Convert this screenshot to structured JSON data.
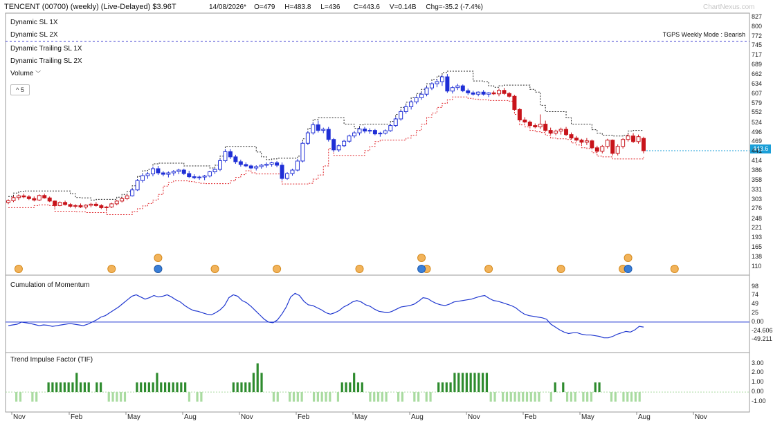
{
  "header": {
    "symbol": "TENCENT (00700)",
    "period": "(weekly)",
    "status": "(Live-Delayed)",
    "mktcap": "$3.96T",
    "date": "14/08/2026*",
    "open": "O=479",
    "high": "H=483.8",
    "low": "L=436",
    "close": "C=443.6",
    "volume": "V=0.14B",
    "change": "Chg=-35.2 (-7.4%)",
    "watermark": "ChartNexus.com"
  },
  "legend": {
    "sl1": "Dynamic SL 1X",
    "sl2": "Dynamic SL 2X",
    "trail1": "Dynamic Trailing SL 1X",
    "trail2": "Dynamic Trailing SL 2X",
    "volume": "Volume",
    "collapse": "^ 5"
  },
  "mode_label": "TGPS Weekly Mode : Bearish",
  "last_price_label": "443.6",
  "colors": {
    "bull": "#1f2fd6",
    "bear": "#c8141b",
    "trail_black": "#222222",
    "trail_red": "#e0262b",
    "momentum": "#2038d0",
    "tif_dark": "#2e8b2e",
    "tif_light": "#a9dba0",
    "price_tag": "#1a9fd8",
    "dashed_blue": "#3a3ad0"
  },
  "x_months": [
    "Nov",
    "Feb",
    "May",
    "Aug",
    "Nov",
    "Feb",
    "May",
    "Aug",
    "Nov",
    "Feb",
    "May",
    "Aug",
    "Nov"
  ],
  "price_ticks": [
    "827",
    "800",
    "772",
    "745",
    "717",
    "689",
    "662",
    "634",
    "607",
    "579",
    "552",
    "524",
    "496",
    "469",
    "441",
    "414",
    "386",
    "358",
    "331",
    "303",
    "276",
    "248",
    "221",
    "193",
    "165",
    "138",
    "110"
  ],
  "momentum_ticks": [
    "98",
    "74",
    "49",
    "25",
    "0.00",
    "-24.606",
    "-49.211"
  ],
  "tif_ticks": [
    "3.00",
    "2.00",
    "1.00",
    "0.00",
    "-1.00"
  ],
  "chart_data": [
    {
      "type": "candlestick",
      "title": "TENCENT (00700) (weekly)",
      "ylim": [
        110,
        827
      ],
      "ohlc": [
        [
          295,
          304,
          290,
          300
        ],
        [
          300,
          314,
          296,
          309
        ],
        [
          309,
          318,
          302,
          314
        ],
        [
          314,
          320,
          307,
          311
        ],
        [
          311,
          316,
          302,
          306
        ],
        [
          306,
          312,
          298,
          302
        ],
        [
          302,
          318,
          299,
          315
        ],
        [
          315,
          320,
          306,
          308
        ],
        [
          308,
          312,
          296,
          299
        ],
        [
          299,
          301,
          280,
          286
        ],
        [
          286,
          298,
          284,
          295
        ],
        [
          295,
          300,
          286,
          289
        ],
        [
          289,
          293,
          280,
          284
        ],
        [
          284,
          290,
          278,
          286
        ],
        [
          286,
          292,
          279,
          282
        ],
        [
          282,
          290,
          276,
          287
        ],
        [
          287,
          294,
          281,
          290
        ],
        [
          290,
          296,
          283,
          286
        ],
        [
          286,
          290,
          276,
          280
        ],
        [
          280,
          285,
          270,
          282
        ],
        [
          282,
          294,
          279,
          291
        ],
        [
          291,
          302,
          287,
          299
        ],
        [
          299,
          310,
          295,
          306
        ],
        [
          306,
          318,
          302,
          314
        ],
        [
          314,
          335,
          312,
          331
        ],
        [
          331,
          362,
          328,
          358
        ],
        [
          358,
          378,
          352,
          372
        ],
        [
          372,
          382,
          363,
          377
        ],
        [
          377,
          398,
          370,
          392
        ],
        [
          392,
          400,
          374,
          380
        ],
        [
          380,
          385,
          370,
          376
        ],
        [
          376,
          384,
          367,
          380
        ],
        [
          380,
          388,
          372,
          384
        ],
        [
          384,
          392,
          376,
          388
        ],
        [
          388,
          392,
          374,
          378
        ],
        [
          378,
          386,
          365,
          369
        ],
        [
          369,
          376,
          362,
          366
        ],
        [
          366,
          372,
          360,
          368
        ],
        [
          368,
          374,
          359,
          371
        ],
        [
          371,
          386,
          367,
          383
        ],
        [
          383,
          394,
          377,
          390
        ],
        [
          390,
          420,
          385,
          415
        ],
        [
          415,
          448,
          410,
          441
        ],
        [
          441,
          448,
          420,
          426
        ],
        [
          426,
          432,
          406,
          412
        ],
        [
          412,
          418,
          398,
          404
        ],
        [
          404,
          410,
          396,
          400
        ],
        [
          400,
          404,
          390,
          394
        ],
        [
          394,
          402,
          387,
          398
        ],
        [
          398,
          406,
          392,
          402
        ],
        [
          402,
          410,
          395,
          405
        ],
        [
          405,
          412,
          398,
          409
        ],
        [
          409,
          414,
          396,
          402
        ],
        [
          402,
          410,
          358,
          364
        ],
        [
          364,
          382,
          360,
          378
        ],
        [
          378,
          392,
          372,
          388
        ],
        [
          388,
          420,
          384,
          414
        ],
        [
          414,
          470,
          410,
          465
        ],
        [
          465,
          500,
          460,
          495
        ],
        [
          495,
          525,
          490,
          518
        ],
        [
          518,
          530,
          496,
          502
        ],
        [
          502,
          510,
          494,
          505
        ],
        [
          505,
          512,
          470,
          476
        ],
        [
          476,
          480,
          440,
          446
        ],
        [
          446,
          462,
          440,
          458
        ],
        [
          458,
          475,
          454,
          471
        ],
        [
          471,
          490,
          466,
          486
        ],
        [
          486,
          500,
          480,
          495
        ],
        [
          495,
          510,
          488,
          506
        ],
        [
          506,
          512,
          494,
          500
        ],
        [
          500,
          508,
          492,
          502
        ],
        [
          502,
          506,
          488,
          492
        ],
        [
          492,
          498,
          484,
          494
        ],
        [
          494,
          505,
          490,
          501
        ],
        [
          501,
          520,
          498,
          516
        ],
        [
          516,
          540,
          512,
          535
        ],
        [
          535,
          560,
          530,
          556
        ],
        [
          556,
          575,
          550,
          570
        ],
        [
          570,
          588,
          562,
          584
        ],
        [
          584,
          600,
          578,
          596
        ],
        [
          596,
          612,
          590,
          606
        ],
        [
          606,
          628,
          600,
          624
        ],
        [
          624,
          640,
          618,
          636
        ],
        [
          636,
          650,
          626,
          642
        ],
        [
          642,
          660,
          630,
          656
        ],
        [
          656,
          664,
          610,
          615
        ],
        [
          615,
          630,
          608,
          625
        ],
        [
          625,
          636,
          618,
          630
        ],
        [
          630,
          634,
          612,
          616
        ],
        [
          616,
          622,
          604,
          610
        ],
        [
          610,
          616,
          602,
          606
        ],
        [
          606,
          614,
          600,
          612
        ],
        [
          612,
          618,
          602,
          606
        ],
        [
          606,
          612,
          598,
          610
        ],
        [
          610,
          616,
          604,
          607
        ],
        [
          607,
          622,
          600,
          617
        ],
        [
          617,
          624,
          604,
          608
        ],
        [
          608,
          612,
          596,
          600
        ],
        [
          600,
          604,
          558,
          562
        ],
        [
          562,
          566,
          528,
          532
        ],
        [
          532,
          540,
          522,
          526
        ],
        [
          526,
          530,
          512,
          516
        ],
        [
          516,
          522,
          508,
          512
        ],
        [
          512,
          548,
          506,
          520
        ],
        [
          520,
          530,
          498,
          502
        ],
        [
          502,
          510,
          490,
          494
        ],
        [
          494,
          504,
          488,
          500
        ],
        [
          500,
          510,
          490,
          505
        ],
        [
          505,
          512,
          486,
          490
        ],
        [
          490,
          496,
          476,
          480
        ],
        [
          480,
          486,
          470,
          474
        ],
        [
          474,
          478,
          462,
          468
        ],
        [
          468,
          480,
          460,
          472
        ],
        [
          472,
          476,
          448,
          452
        ],
        [
          452,
          458,
          438,
          442
        ],
        [
          442,
          460,
          436,
          456
        ],
        [
          456,
          478,
          450,
          474
        ],
        [
          474,
          476,
          430,
          436
        ],
        [
          436,
          462,
          430,
          456
        ],
        [
          456,
          480,
          450,
          476
        ],
        [
          476,
          492,
          470,
          486
        ],
        [
          486,
          494,
          466,
          470
        ],
        [
          470,
          490,
          464,
          484
        ],
        [
          479,
          483.8,
          436,
          443.6
        ]
      ]
    },
    {
      "type": "line",
      "title": "Cumulation of Momentum",
      "ylim": [
        -60,
        100
      ],
      "values": [
        -10,
        -8,
        -6,
        0,
        -2,
        -4,
        -7,
        -10,
        -8,
        -9,
        -12,
        -10,
        -8,
        -6,
        -4,
        -6,
        -8,
        -10,
        -6,
        0,
        6,
        14,
        18,
        26,
        34,
        42,
        52,
        62,
        72,
        76,
        70,
        64,
        68,
        74,
        70,
        72,
        76,
        70,
        62,
        56,
        46,
        38,
        32,
        30,
        26,
        22,
        20,
        26,
        34,
        46,
        68,
        76,
        72,
        60,
        54,
        44,
        32,
        20,
        8,
        0,
        -2,
        6,
        22,
        42,
        70,
        80,
        74,
        58,
        48,
        46,
        40,
        34,
        26,
        22,
        26,
        32,
        42,
        48,
        56,
        60,
        56,
        48,
        44,
        36,
        30,
        28,
        26,
        30,
        36,
        42,
        44,
        46,
        50,
        58,
        68,
        66,
        58,
        52,
        48,
        46,
        50,
        56,
        58,
        60,
        62,
        64,
        68,
        72,
        74,
        66,
        60,
        58,
        54,
        50,
        46,
        40,
        30,
        22,
        18,
        16,
        14,
        12,
        8,
        -6,
        -14,
        -22,
        -28,
        -32,
        -30,
        -30,
        -34,
        -36,
        -36,
        -38,
        -40,
        -44,
        -44,
        -40,
        -34,
        -30,
        -26,
        -28,
        -22,
        -12,
        -14
      ]
    },
    {
      "type": "bar",
      "title": "Trend Impulse Factor (TIF)",
      "ylim": [
        -1.8,
        3.4
      ],
      "values": [
        0,
        0,
        -1,
        -1,
        0,
        0,
        -1,
        -1,
        0,
        0,
        1,
        1,
        1,
        1,
        1,
        1,
        1,
        2,
        1,
        1,
        1,
        0,
        1,
        1,
        0,
        -1,
        -1,
        -1,
        -1,
        -1,
        0,
        0,
        1,
        1,
        1,
        1,
        1,
        2,
        1,
        1,
        1,
        1,
        1,
        1,
        1,
        -1,
        0,
        -1,
        -1,
        0,
        0,
        0,
        0,
        0,
        0,
        0,
        1,
        1,
        1,
        1,
        1,
        2,
        3,
        2,
        0,
        0,
        -1,
        -1,
        0,
        0,
        -1,
        -1,
        -1,
        -1,
        0,
        0,
        -1,
        -1,
        -1,
        -1,
        -1,
        0,
        -1,
        1,
        1,
        1,
        2,
        1,
        1,
        0,
        -1,
        -1,
        -1,
        -1,
        -1,
        0,
        0,
        -1,
        -1,
        0,
        0,
        -1,
        -1,
        0,
        -1,
        -1,
        0,
        1,
        1,
        1,
        1,
        2,
        2,
        2,
        2,
        2,
        2,
        2,
        2,
        2,
        -1,
        -1,
        0,
        -1,
        -1,
        -1,
        -1,
        -1,
        -1,
        -1,
        -1,
        -1,
        -1,
        0,
        0,
        -1,
        1,
        0,
        1,
        -1,
        -1,
        -1,
        0,
        -1,
        -1,
        -1,
        1,
        1,
        0,
        0,
        -1,
        -1,
        0,
        -1,
        -1,
        -1,
        -1,
        -1,
        0
      ]
    }
  ]
}
